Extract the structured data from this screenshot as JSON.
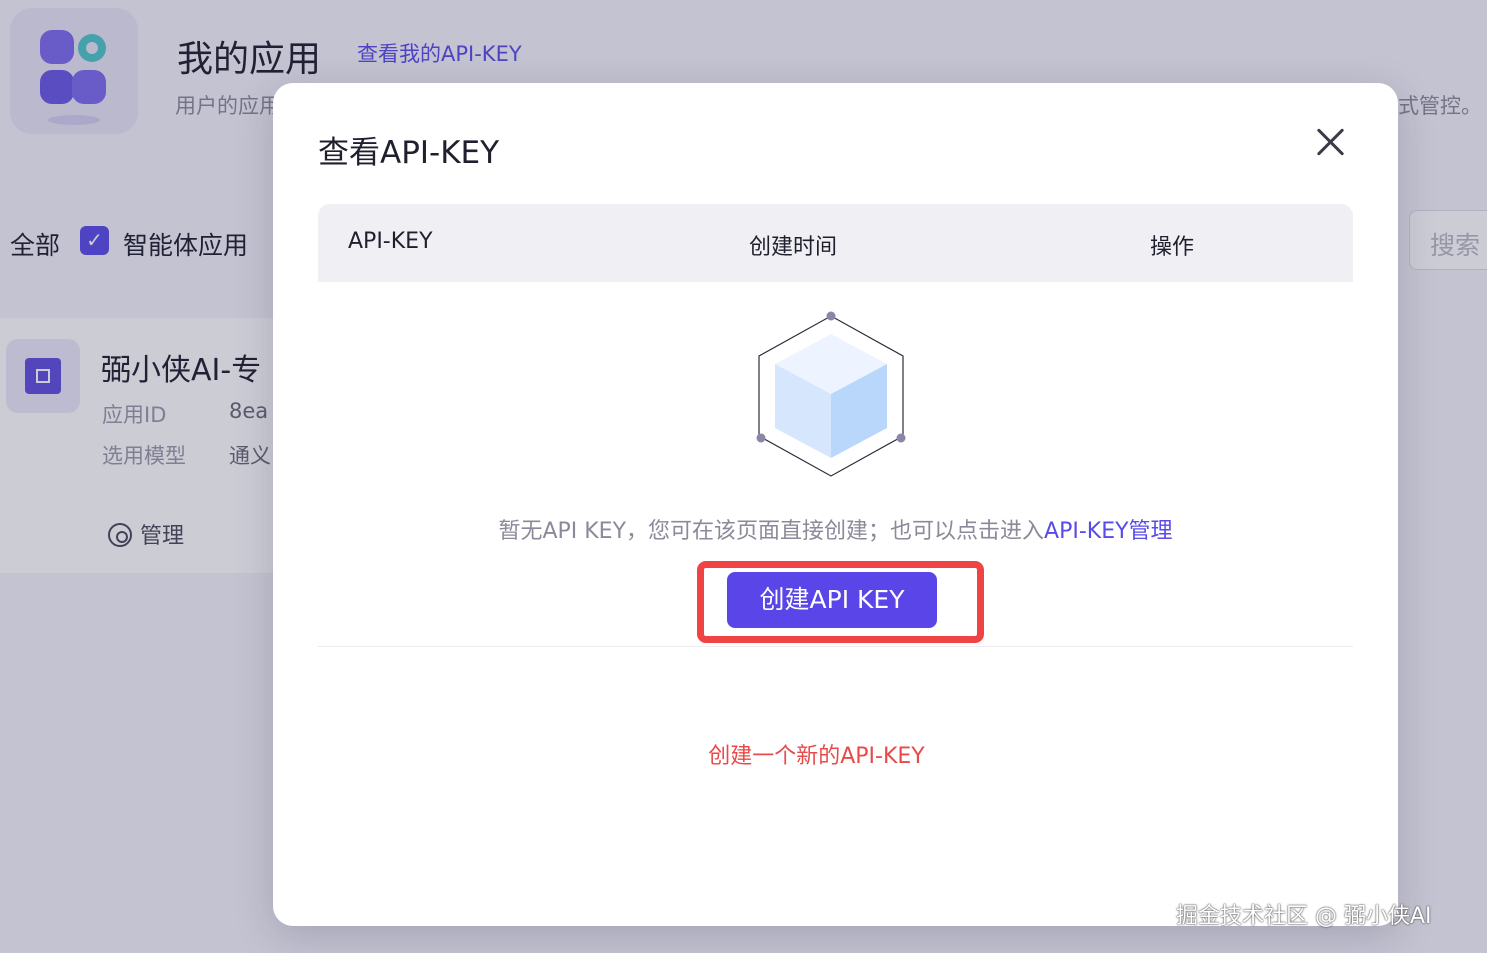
{
  "background": {
    "title": "我的应用",
    "view_key_link": "查看我的API-KEY",
    "description": "用户的应用",
    "description_tail": "式管控。",
    "filters": {
      "all": "全部",
      "agent_apps": "智能体应用",
      "agent_checked": true
    },
    "search_placeholder": "搜索",
    "card": {
      "title": "弼小侠AI-专",
      "app_id_label": "应用ID",
      "app_id_value": "8ea",
      "model_label": "选用模型",
      "model_value": "通义",
      "manage_label": "管理"
    }
  },
  "modal": {
    "title": "查看API-KEY",
    "columns": [
      "API-KEY",
      "创建时间",
      "操作"
    ],
    "rows": [],
    "empty_text": "暂无API KEY，您可在该页面直接创建；也可以点击进入",
    "empty_link": "API-KEY管理",
    "create_button": "创建API KEY",
    "annotation": "创建一个新的API-KEY",
    "annotation_color": "#e84a4a",
    "accent_color": "#5a45e8"
  },
  "watermark": "掘金技术社区 @ 弼小侠AI"
}
